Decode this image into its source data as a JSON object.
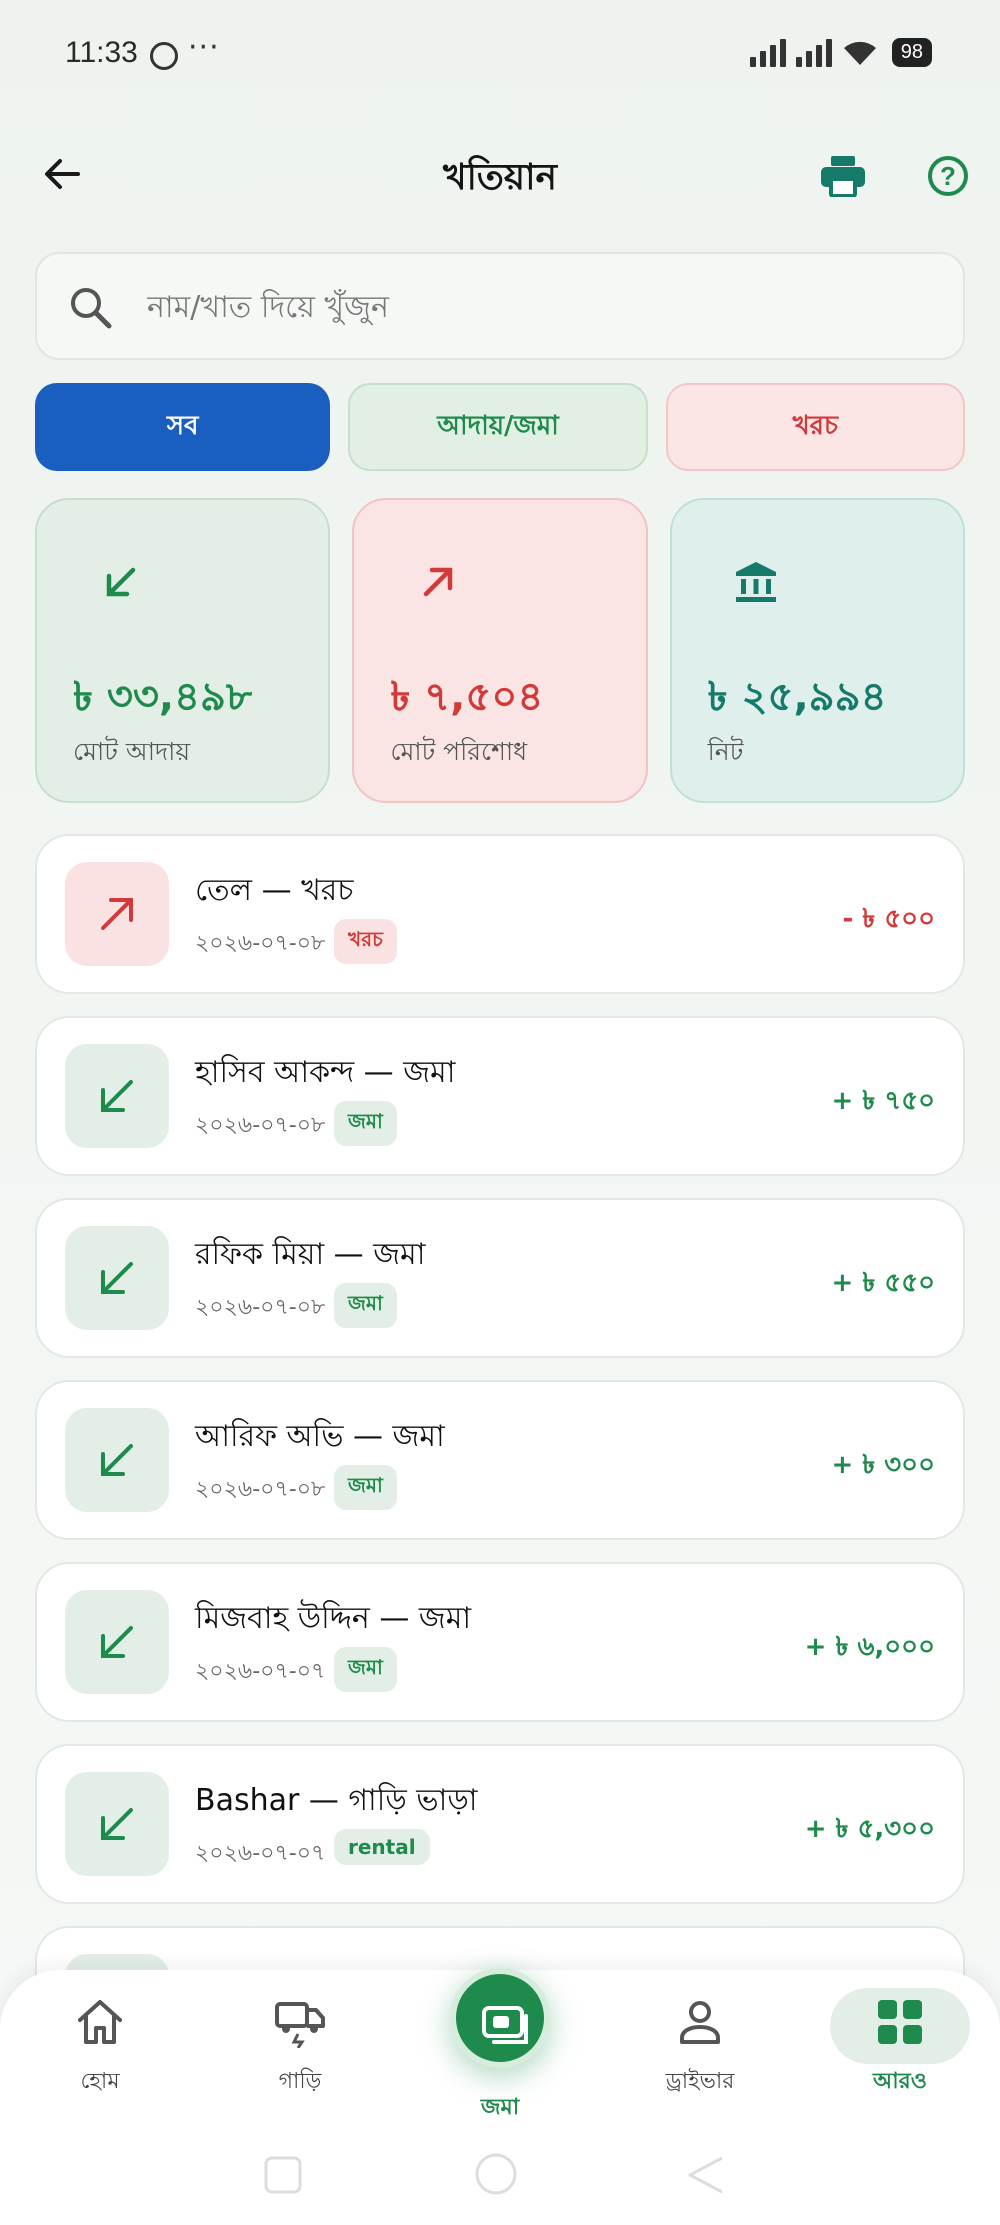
{
  "status_bar": {
    "time": "11:33",
    "battery": "98",
    "dots": "···"
  },
  "header": {
    "title": "খতিয়ান"
  },
  "search": {
    "placeholder": "নাম/খাত দিয়ে খুঁজুন"
  },
  "filters": {
    "all": "সব",
    "income": "আদায়/জমা",
    "expense": "খরচ"
  },
  "summary": {
    "income": {
      "value": "৳ ৩৩,৪৯৮",
      "label": "মোট আদায়"
    },
    "expense": {
      "value": "৳ ৭,৫০৪",
      "label": "মোট পরিশোধ"
    },
    "net": {
      "value": "৳ ২৫,৯৯৪",
      "label": "নিট"
    }
  },
  "transactions": [
    {
      "name": "তেল — খরচ",
      "date": "২০২৬-০৭-০৮",
      "tag": "খরচ",
      "amount": "- ৳ ৫০০",
      "direction": "out"
    },
    {
      "name": "হাসিব আকন্দ — জমা",
      "date": "২০২৬-০৭-০৮",
      "tag": "জমা",
      "amount": "+ ৳ ৭৫০",
      "direction": "in"
    },
    {
      "name": "রফিক মিয়া — জমা",
      "date": "২০২৬-০৭-০৮",
      "tag": "জমা",
      "amount": "+ ৳ ৫৫০",
      "direction": "in"
    },
    {
      "name": "আরিফ অভি — জমা",
      "date": "২০২৬-০৭-০৮",
      "tag": "জমা",
      "amount": "+ ৳ ৩০০",
      "direction": "in"
    },
    {
      "name": "মিজবাহ উদ্দিন — জমা",
      "date": "২০২৬-০৭-০৭",
      "tag": "জমা",
      "amount": "+ ৳ ৬,০০০",
      "direction": "in"
    },
    {
      "name": "Bashar — গাড়ি ভাড়া",
      "date": "২০২৬-০৭-০৭",
      "tag": "rental",
      "amount": "+ ৳ ৫,৩০০",
      "direction": "in"
    }
  ],
  "bottom_nav": {
    "home": "হোম",
    "vehicles": "গাড়ি",
    "deposit": "জমা",
    "driver": "ড্রাইভার",
    "more": "আরও"
  },
  "colors": {
    "primary_blue": "#1a5fbf",
    "green": "#1e8a4c",
    "red": "#d23a3a",
    "teal": "#157a6a"
  }
}
